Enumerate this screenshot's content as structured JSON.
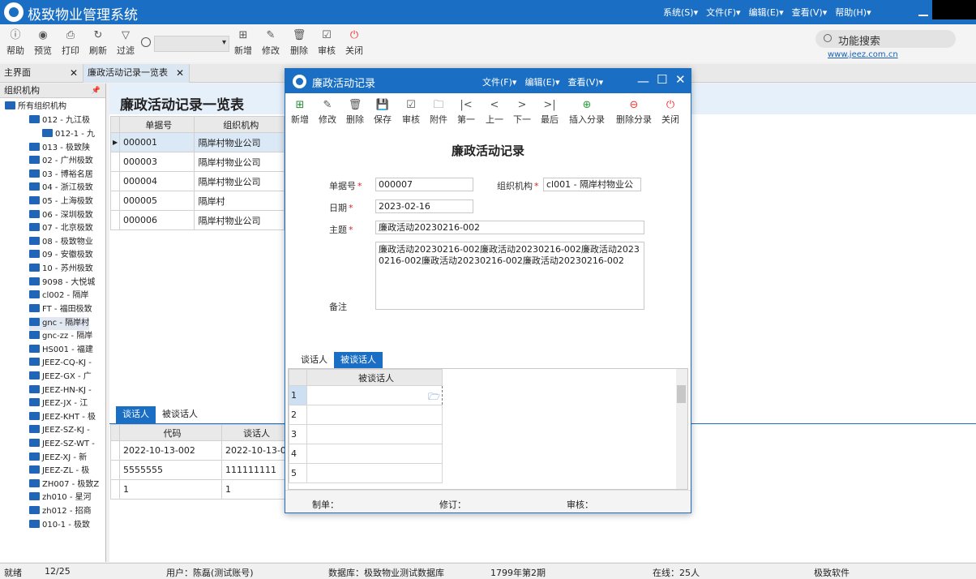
{
  "app": {
    "title": "极致物业管理系统",
    "menu": [
      "系统(S)▾",
      "文件(F)▾",
      "编辑(E)▾",
      "查看(V)▾",
      "帮助(H)▾"
    ]
  },
  "toolbar": {
    "help": "帮助",
    "preview": "预览",
    "print": "打印",
    "refresh": "刷新",
    "filter": "过滤",
    "add": "新增",
    "edit": "修改",
    "delete": "删除",
    "audit": "审核",
    "close": "关闭",
    "function_search": "功能搜索",
    "site": "www.jeez.com.cn"
  },
  "tabs": {
    "home": "主界面",
    "list": "廉政活动记录一览表",
    "close": "✕"
  },
  "tree": {
    "header": "组织机构",
    "pin": "📌",
    "items": [
      "所有组织机构",
      "012 - 九江极",
      "012-1 - 九",
      "013 - 极致陕",
      "02 - 广州极致",
      "03 - 博裕名居",
      "04 - 浙江极致",
      "05 - 上海极致",
      "06 - 深圳极致",
      "07 - 北京极致",
      "08 - 极致物业",
      "09 - 安徽极致",
      "10 - 苏州极致",
      "9098 - 大悦城",
      "cl002 - 隔岸",
      "FT - 福田极致",
      "gnc - 隔岸村",
      "gnc-zz - 隔岸",
      "HS001 - 福建",
      "JEEZ-CQ-KJ -",
      "JEEZ-GX - 广",
      "JEEZ-HN-KJ -",
      "JEEZ-JX - 江",
      "JEEZ-KHT - 极",
      "JEEZ-SZ-KJ -",
      "JEEZ-SZ-WT -",
      "JEEZ-XJ - 新",
      "JEEZ-ZL - 极",
      "ZH007 - 极致Z",
      "zh010 - 星河",
      "zh012 - 招商",
      "010-1 - 极致"
    ]
  },
  "list": {
    "title": "廉政活动记录一览表",
    "columns": [
      "单据号",
      "组织机构"
    ],
    "rows": [
      [
        "000001",
        "隔岸村物业公司"
      ],
      [
        "000003",
        "隔岸村物业公司"
      ],
      [
        "000004",
        "隔岸村物业公司"
      ],
      [
        "000005",
        "隔岸村"
      ],
      [
        "000006",
        "隔岸村物业公司"
      ]
    ],
    "subtabs": [
      "谈话人",
      "被谈话人"
    ],
    "sub_columns": [
      "代码",
      "谈话人"
    ],
    "sub_rows": [
      [
        "2022-10-13-002",
        "2022-10-13-0"
      ],
      [
        "5555555",
        "111111111"
      ],
      [
        "1",
        "1"
      ]
    ]
  },
  "modal": {
    "title": "廉政活动记录",
    "menu": [
      "文件(F)▾",
      "编辑(E)▾",
      "查看(V)▾"
    ],
    "toolbar": [
      "新增",
      "修改",
      "删除",
      "保存",
      "审核",
      "附件",
      "第一",
      "上一",
      "下一",
      "最后",
      "插入分录",
      "删除分录",
      "关闭"
    ],
    "form_title": "廉政活动记录",
    "fields": {
      "doc_no_label": "单据号",
      "doc_no": "000007",
      "org_label": "组织机构",
      "org": "cl001 - 隔岸村物业公",
      "date_label": "日期",
      "date": "2023-02-16",
      "subject_label": "主题",
      "subject": "廉政活动20230216-002",
      "remark_label": "备注",
      "remark": "廉政活动20230216-002廉政活动20230216-002廉政活动20230216-002廉政活动20230216-002廉政活动20230216-002"
    },
    "tabs": [
      "谈话人",
      "被谈话人"
    ],
    "grid_header": "被谈话人",
    "grid_rows": [
      "1",
      "2",
      "3",
      "4",
      "5"
    ],
    "footer": {
      "maker": "制单：",
      "revise": "修订：",
      "audit": "审核："
    }
  },
  "status": {
    "state": "就绪",
    "count": "12/25",
    "user": "用户：陈磊(测试账号)",
    "db": "数据库：极致物业测试数据库",
    "period": "1799年第2期",
    "online": "在线：25人",
    "company": "极致软件"
  }
}
